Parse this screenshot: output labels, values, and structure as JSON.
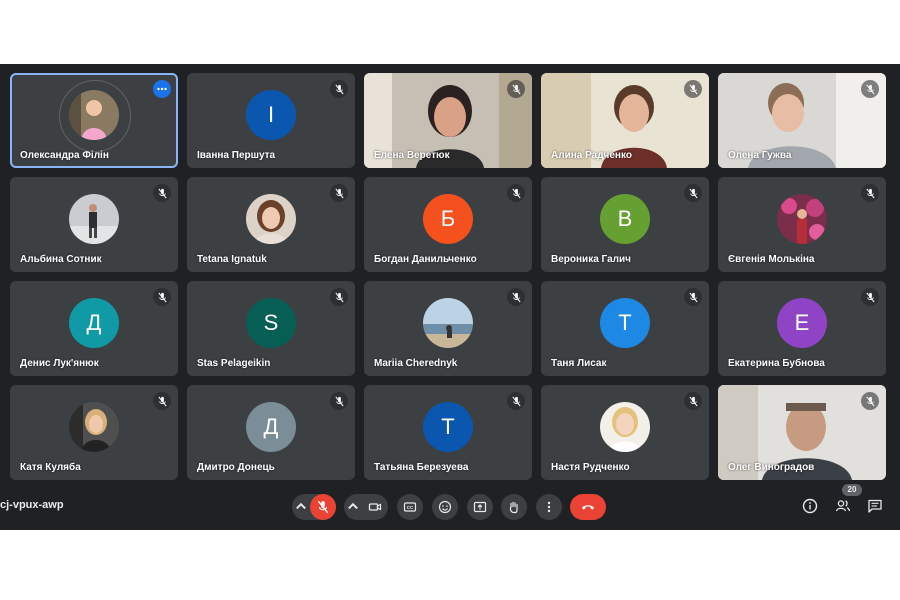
{
  "meeting": {
    "code": "cj-vpux-awp",
    "participant_count": "20"
  },
  "participants": [
    {
      "name": "Олександра Філін",
      "type": "photo",
      "active": true
    },
    {
      "name": "Іванна Першута",
      "type": "letter",
      "letter": "І",
      "color": "#0b57b0"
    },
    {
      "name": "Елена Веретюк",
      "type": "video"
    },
    {
      "name": "Алина Радченко",
      "type": "video"
    },
    {
      "name": "Олена Гужва",
      "type": "video"
    },
    {
      "name": "Альбина Сотник",
      "type": "photo"
    },
    {
      "name": "Tetana Ignatuk",
      "type": "photo"
    },
    {
      "name": "Богдан Данильченко",
      "type": "letter",
      "letter": "Б",
      "color": "#f4511e"
    },
    {
      "name": "Вероника Галич",
      "type": "letter",
      "letter": "В",
      "color": "#66a033"
    },
    {
      "name": "Євгенія Молькіна",
      "type": "photo"
    },
    {
      "name": "Денис Лук'янюк",
      "type": "letter",
      "letter": "Д",
      "color": "#0f9aa6"
    },
    {
      "name": "Stas Pelageikin",
      "type": "letter",
      "letter": "S",
      "color": "#075e54"
    },
    {
      "name": "Mariia Cherednyk",
      "type": "photo"
    },
    {
      "name": "Таня Лисак",
      "type": "letter",
      "letter": "Т",
      "color": "#1e88e5"
    },
    {
      "name": "Екатерина Бубнова",
      "type": "letter",
      "letter": "Е",
      "color": "#8e44c4"
    },
    {
      "name": "Катя Куляба",
      "type": "photo"
    },
    {
      "name": "Дмитро Донець",
      "type": "letter",
      "letter": "Д",
      "color": "#7b8d96"
    },
    {
      "name": "Татьяна Березуева",
      "type": "letter",
      "letter": "Т",
      "color": "#0b57b0"
    },
    {
      "name": "Настя Рудченко",
      "type": "photo"
    },
    {
      "name": "Олег Виноградов",
      "type": "video"
    }
  ],
  "icons": {
    "mic_off": "mic-off-icon",
    "more": "more-options-icon",
    "camera": "camera-icon",
    "captions": "captions-icon",
    "emoji": "emoji-icon",
    "present": "present-icon",
    "hand": "raise-hand-icon",
    "info": "info-icon",
    "people": "people-icon",
    "chat": "chat-icon"
  },
  "colors": {
    "background": "#202124",
    "tile": "#3c4043",
    "active_border": "#8ab4f8",
    "hangup": "#ea4335"
  }
}
